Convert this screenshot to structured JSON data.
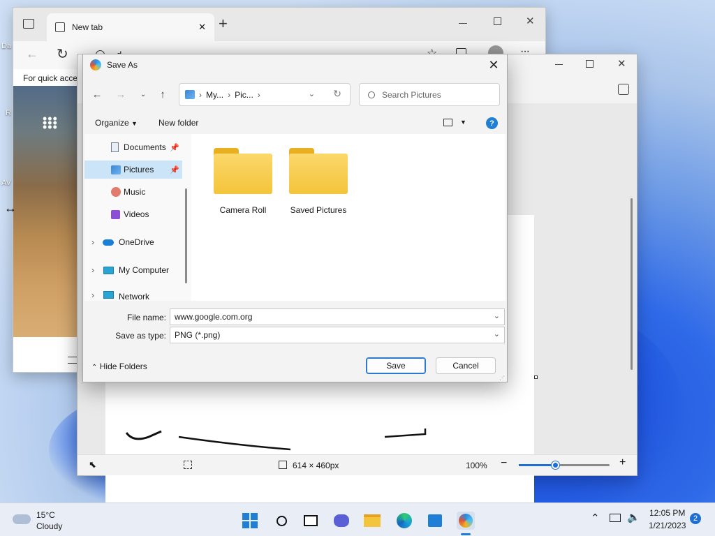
{
  "desktop": {
    "icon_labels": [
      "Da",
      "R",
      "AV"
    ]
  },
  "edge": {
    "tab_title": "New tab",
    "new_tab_symbol": "+",
    "address_text": "d",
    "quick_access_text": "For quick acce",
    "menu_dots": "···"
  },
  "paint": {
    "dimensions": "614 × 460px",
    "zoom": "100%",
    "zoom_level": 0.4
  },
  "dialog": {
    "title": "Save As",
    "breadcrumb": [
      "My...",
      "Pic..."
    ],
    "search_placeholder": "Search Pictures",
    "organize_label": "Organize",
    "new_folder_label": "New folder",
    "help_symbol": "?",
    "nav_items": [
      {
        "label": "Documents",
        "pinned": true
      },
      {
        "label": "Pictures",
        "pinned": true
      },
      {
        "label": "Music",
        "pinned": false
      },
      {
        "label": "Videos",
        "pinned": false
      },
      {
        "label": "OneDrive",
        "pinned": false
      },
      {
        "label": "My Computer",
        "pinned": false
      },
      {
        "label": "Network",
        "pinned": false
      }
    ],
    "folders": [
      "Camera Roll",
      "Saved Pictures"
    ],
    "file_name_label": "File name:",
    "file_name_value": "www.google.com.org",
    "save_type_label": "Save as type:",
    "save_type_value": "PNG (*.png)",
    "hide_folders_label": "Hide Folders",
    "save_label": "Save",
    "cancel_label": "Cancel"
  },
  "taskbar": {
    "temperature": "15°C",
    "condition": "Cloudy",
    "time": "12:05 PM",
    "date": "1/21/2023",
    "notification_count": "2"
  }
}
